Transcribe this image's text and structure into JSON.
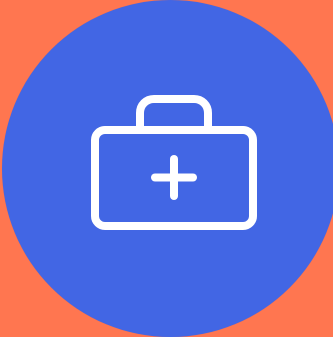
{
  "app_icon": {
    "icon_name": "medical-kit-icon",
    "background_color": "#ff7650",
    "circle_color": "#4266e4",
    "stroke_color": "#ffffff"
  }
}
